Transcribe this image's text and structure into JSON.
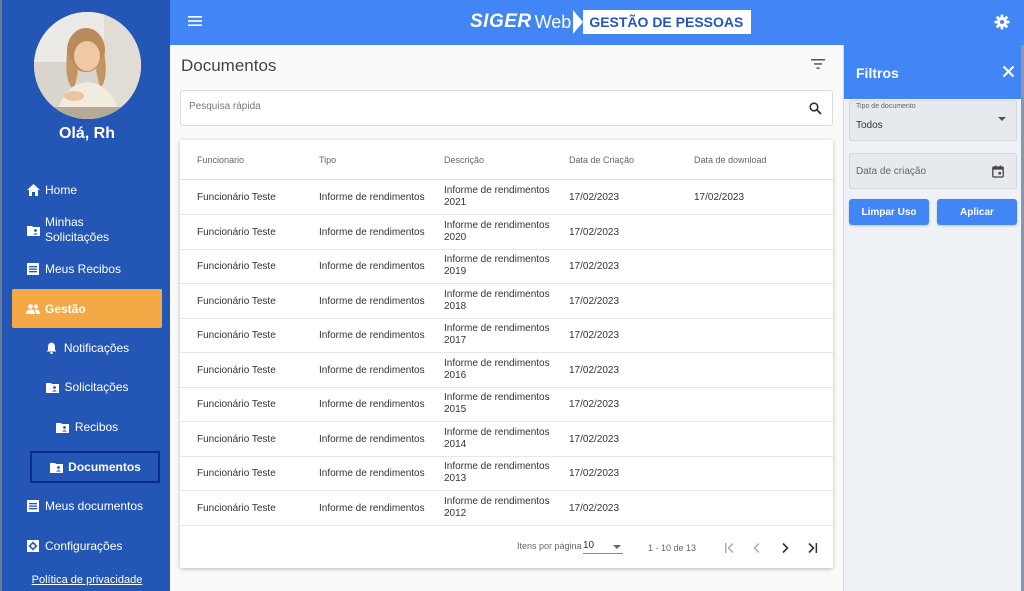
{
  "app": {
    "brand_siger": "SIGER",
    "brand_web": "Web",
    "brand_module": "GESTÃO DE PESSOAS"
  },
  "sidebar": {
    "greeting": "Olá, Rh",
    "items": [
      {
        "label": "Home",
        "icon": "home-icon"
      },
      {
        "label": "Minhas Solicitações",
        "icon": "folder-person-icon"
      },
      {
        "label": "Meus Recibos",
        "icon": "list-icon"
      },
      {
        "label": "Gestão",
        "icon": "people-icon"
      },
      {
        "label": "Notificações",
        "icon": "bell-icon"
      },
      {
        "label": "Solicitações",
        "icon": "folder-person-icon"
      },
      {
        "label": "Recibos",
        "icon": "folder-person-icon"
      },
      {
        "label": "Documentos",
        "icon": "folder-person-icon"
      },
      {
        "label": "Meus documentos",
        "icon": "list-icon"
      },
      {
        "label": "Configurações",
        "icon": "settings-box-icon"
      }
    ],
    "privacy": "Política de privacidade",
    "active_color": "#f5a846"
  },
  "main": {
    "title": "Documentos",
    "search_placeholder": "Pesquisa rápida",
    "columns": [
      "Funcionario",
      "Tipo",
      "Descrição",
      "Data de Criação",
      "Data de download"
    ],
    "rows": [
      {
        "funcionario": "Funcionário Teste",
        "tipo": "Informe de rendimentos",
        "desc1": "Informe de rendimentos",
        "desc2": "2021",
        "criacao": "17/02/2023",
        "download": "17/02/2023"
      },
      {
        "funcionario": "Funcionário Teste",
        "tipo": "Informe de rendimentos",
        "desc1": "Informe de rendimentos",
        "desc2": "2020",
        "criacao": "17/02/2023",
        "download": ""
      },
      {
        "funcionario": "Funcionário Teste",
        "tipo": "Informe de rendimentos",
        "desc1": "Informe de rendimentos",
        "desc2": "2019",
        "criacao": "17/02/2023",
        "download": ""
      },
      {
        "funcionario": "Funcionário Teste",
        "tipo": "Informe de rendimentos",
        "desc1": "Informe de rendimentos",
        "desc2": "2018",
        "criacao": "17/02/2023",
        "download": ""
      },
      {
        "funcionario": "Funcionário Teste",
        "tipo": "Informe de rendimentos",
        "desc1": "Informe de rendimentos",
        "desc2": "2017",
        "criacao": "17/02/2023",
        "download": ""
      },
      {
        "funcionario": "Funcionário Teste",
        "tipo": "Informe de rendimentos",
        "desc1": "Informe de rendimentos",
        "desc2": "2016",
        "criacao": "17/02/2023",
        "download": ""
      },
      {
        "funcionario": "Funcionário Teste",
        "tipo": "Informe de rendimentos",
        "desc1": "Informe de rendimentos",
        "desc2": "2015",
        "criacao": "17/02/2023",
        "download": ""
      },
      {
        "funcionario": "Funcionário Teste",
        "tipo": "Informe de rendimentos",
        "desc1": "Informe de rendimentos",
        "desc2": "2014",
        "criacao": "17/02/2023",
        "download": ""
      },
      {
        "funcionario": "Funcionário Teste",
        "tipo": "Informe de rendimentos",
        "desc1": "Informe de rendimentos",
        "desc2": "2013",
        "criacao": "17/02/2023",
        "download": ""
      },
      {
        "funcionario": "Funcionário Teste",
        "tipo": "Informe de rendimentos",
        "desc1": "Informe de rendimentos",
        "desc2": "2012",
        "criacao": "17/02/2023",
        "download": ""
      }
    ],
    "paginator": {
      "label": "Itens por página",
      "page_size": "10",
      "range": "1 - 10 de 13"
    }
  },
  "filters": {
    "title": "Filtros",
    "doc_type_label": "Tipo de documento",
    "doc_type_value": "Todos",
    "date_placeholder": "Data de criação",
    "clear_label": "Limpar Uso",
    "apply_label": "Aplicar"
  },
  "colors": {
    "sidebar": "#2457b5",
    "topbar": "#4285f4",
    "accent": "#f5a846"
  }
}
